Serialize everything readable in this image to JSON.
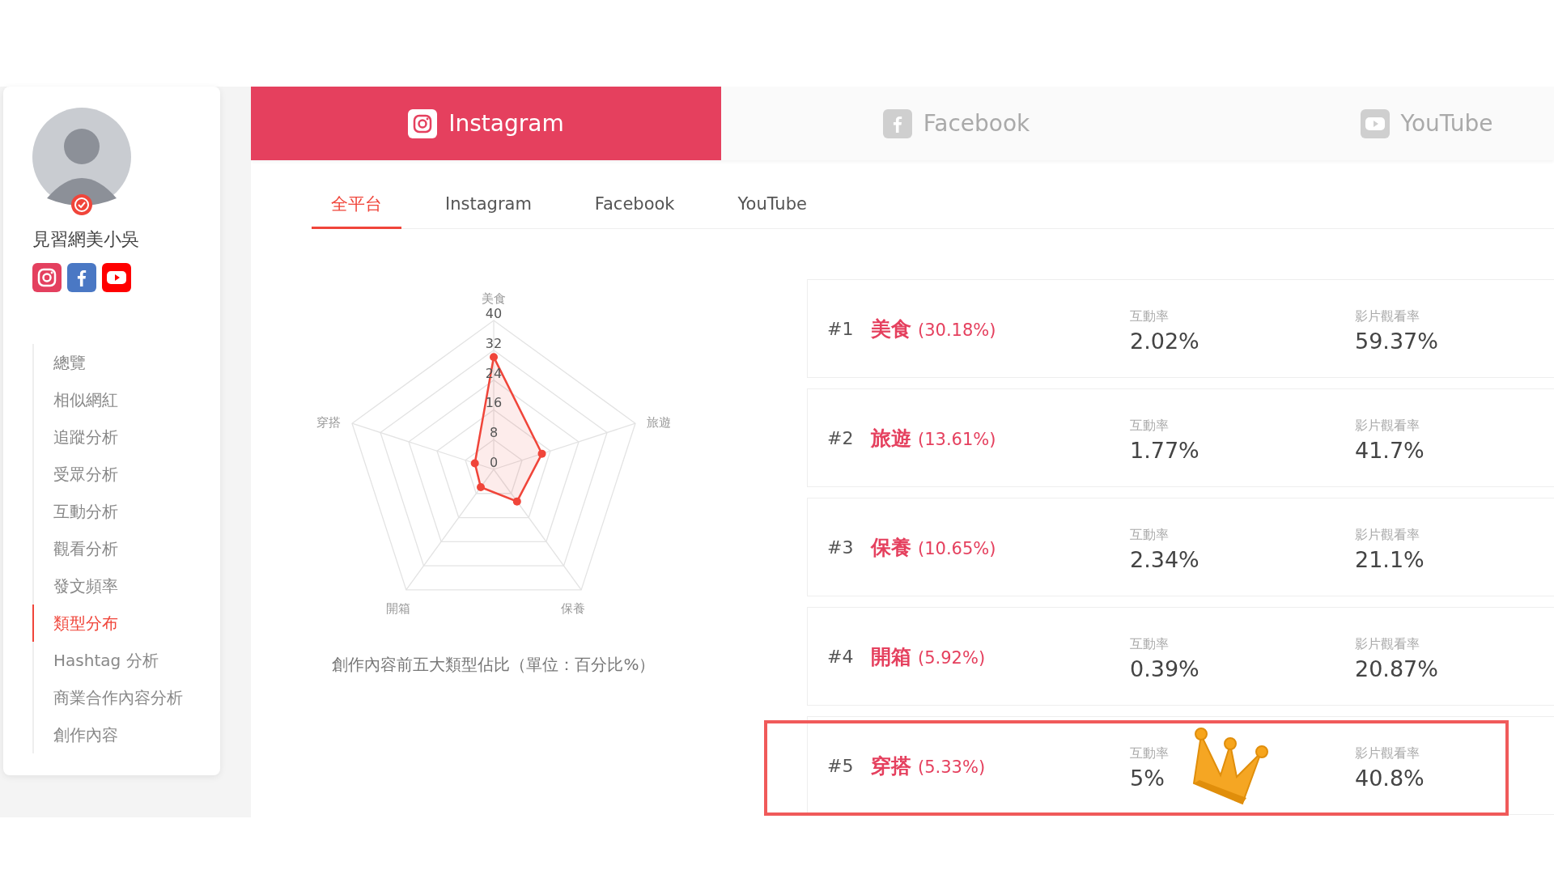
{
  "profile": {
    "name": "見習網美小吳",
    "verified": true,
    "socials": [
      {
        "kind": "instagram"
      },
      {
        "kind": "facebook"
      },
      {
        "kind": "youtube"
      }
    ]
  },
  "menu": [
    {
      "label": "總覽",
      "selected": false
    },
    {
      "label": "相似網紅",
      "selected": false
    },
    {
      "label": "追蹤分析",
      "selected": false
    },
    {
      "label": "受眾分析",
      "selected": false
    },
    {
      "label": "互動分析",
      "selected": false
    },
    {
      "label": "觀看分析",
      "selected": false
    },
    {
      "label": "發文頻率",
      "selected": false
    },
    {
      "label": "類型分布",
      "selected": true
    },
    {
      "label": "Hashtag 分析",
      "selected": false
    },
    {
      "label": "商業合作內容分析",
      "selected": false
    },
    {
      "label": "創作內容",
      "selected": false
    }
  ],
  "platform_tabs": [
    {
      "label": "Instagram",
      "kind": "instagram",
      "selected": true
    },
    {
      "label": "Facebook",
      "kind": "facebook",
      "selected": false
    },
    {
      "label": "YouTube",
      "kind": "youtube",
      "selected": false
    }
  ],
  "sub_tabs": [
    {
      "label": "全平台",
      "selected": true
    },
    {
      "label": "Instagram",
      "selected": false
    },
    {
      "label": "Facebook",
      "selected": false
    },
    {
      "label": "YouTube",
      "selected": false
    }
  ],
  "chart": {
    "caption": "創作內容前五大類型佔比（單位：百分比%）",
    "chart_data": {
      "type": "radar",
      "categories": [
        "美食",
        "旅遊",
        "保養",
        "開箱",
        "穿搭"
      ],
      "values": [
        30.18,
        13.61,
        10.65,
        5.92,
        5.33
      ],
      "ylim": [
        0,
        40
      ],
      "yticks": [
        0,
        8,
        16,
        24,
        32,
        40
      ]
    }
  },
  "categories": [
    {
      "rank": "#1",
      "name": "美食",
      "share": "(30.18%)",
      "engagement_label": "互動率",
      "engagement": "2.02%",
      "view_label": "影片觀看率",
      "view_rate": "59.37%",
      "highlighted": false
    },
    {
      "rank": "#2",
      "name": "旅遊",
      "share": "(13.61%)",
      "engagement_label": "互動率",
      "engagement": "1.77%",
      "view_label": "影片觀看率",
      "view_rate": "41.7%",
      "highlighted": false
    },
    {
      "rank": "#3",
      "name": "保養",
      "share": "(10.65%)",
      "engagement_label": "互動率",
      "engagement": "2.34%",
      "view_label": "影片觀看率",
      "view_rate": "21.1%",
      "highlighted": false
    },
    {
      "rank": "#4",
      "name": "開箱",
      "share": "(5.92%)",
      "engagement_label": "互動率",
      "engagement": "0.39%",
      "view_label": "影片觀看率",
      "view_rate": "20.87%",
      "highlighted": false
    },
    {
      "rank": "#5",
      "name": "穿搭",
      "share": "(5.33%)",
      "engagement_label": "互動率",
      "engagement": "5%",
      "view_label": "影片觀看率",
      "view_rate": "40.8%",
      "highlighted": true
    }
  ]
}
